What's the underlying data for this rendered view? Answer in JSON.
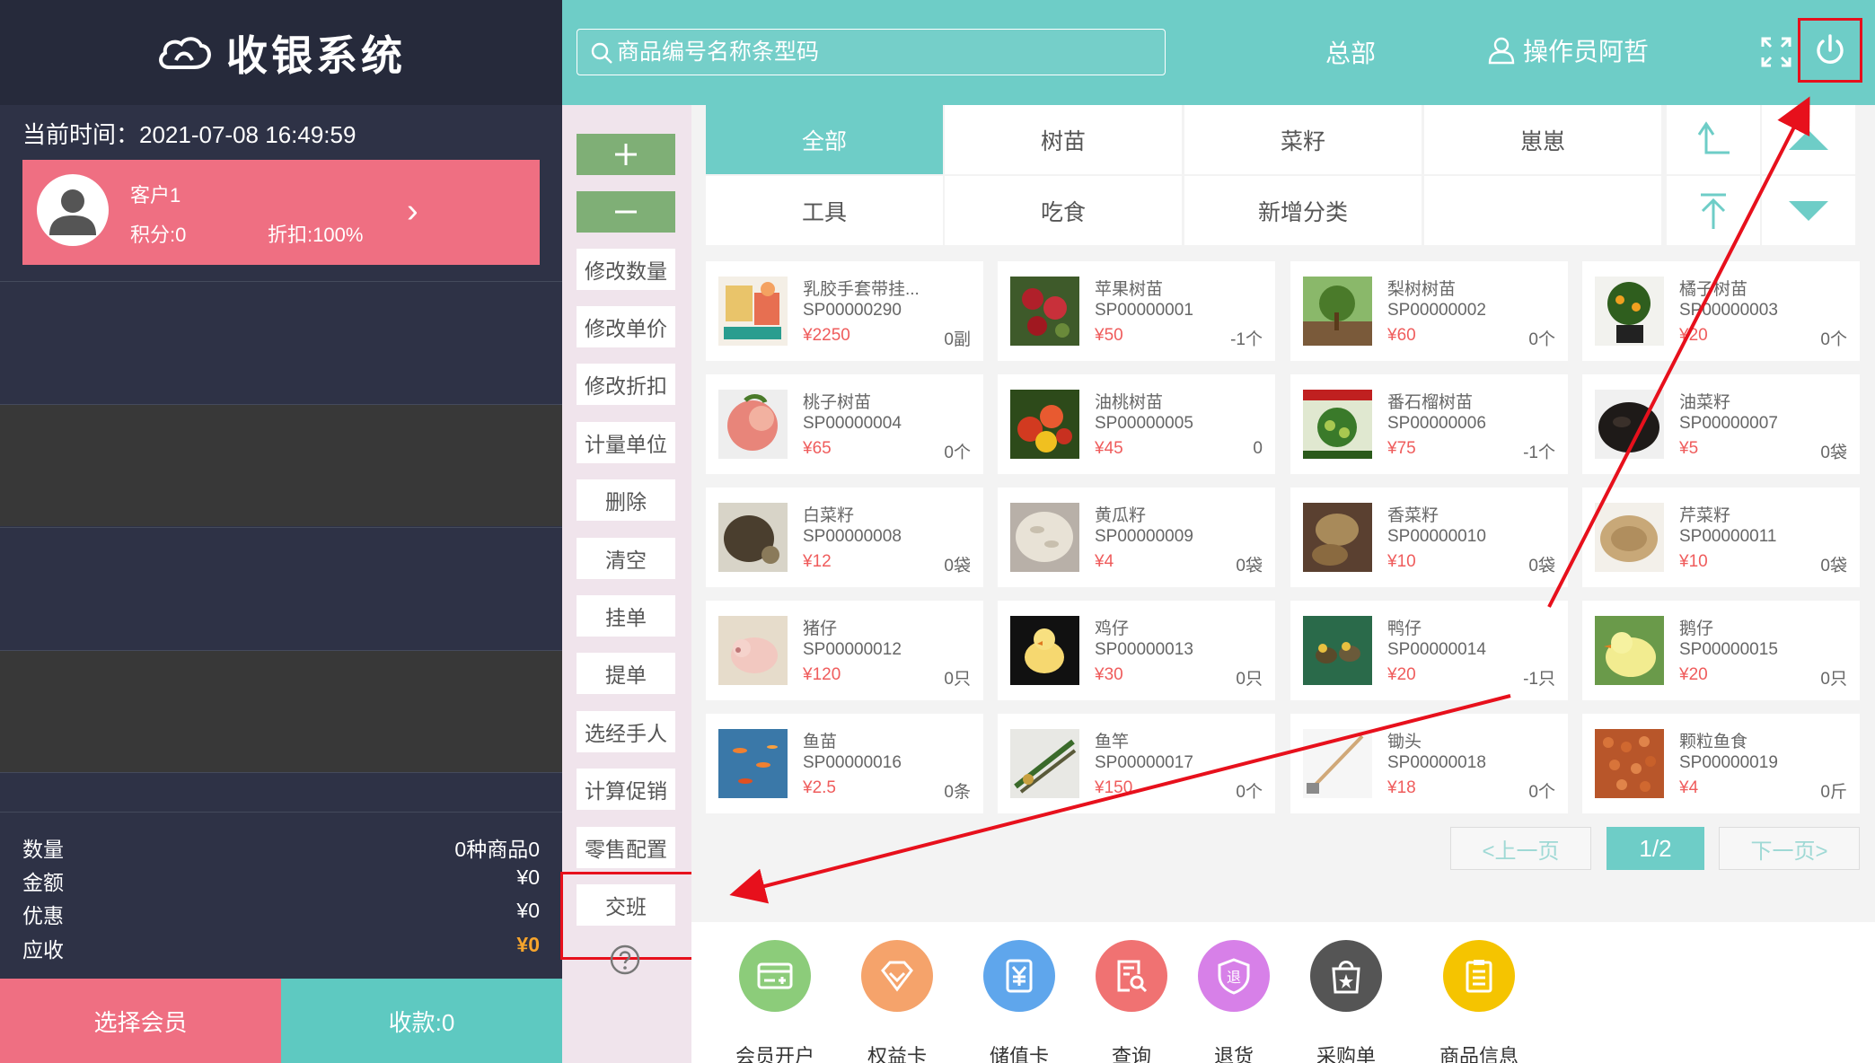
{
  "app": {
    "title": "收银系统"
  },
  "left": {
    "time_label": "当前时间：",
    "time_value": "2021-07-08 16:49:59",
    "customer": {
      "name": "客户1",
      "points": "积分:0",
      "discount": "折扣:100%",
      "arrow": "›"
    },
    "summary": {
      "qty_label": "数量",
      "qty_value": "0种商品0",
      "amount_label": "金额",
      "amount_value": "¥0",
      "discount_label": "优惠",
      "discount_value": "¥0",
      "due_label": "应收",
      "due_value": "¥0"
    },
    "select_member": "选择会员",
    "collect": "收款:0"
  },
  "topbar": {
    "search_placeholder": "商品编号名称条型码",
    "store": "总部",
    "operator": "操作员阿哲",
    "icons": [
      "search-icon",
      "user-icon",
      "fullscreen-icon",
      "power-icon"
    ]
  },
  "functions": {
    "add": "+",
    "minus": "—",
    "buttons": [
      "修改数量",
      "修改单价",
      "修改折扣",
      "计量单位",
      "删除",
      "清空",
      "挂单",
      "提单",
      "选经手人",
      "计算促销",
      "零售配置",
      "交班"
    ]
  },
  "categories": {
    "row1": [
      "全部",
      "树苗",
      "菜籽",
      "崽崽"
    ],
    "row2": [
      "工具",
      "吃食",
      "新增分类",
      ""
    ],
    "active": "全部"
  },
  "products": [
    {
      "name": "乳胶手套带挂...",
      "code": "SP00000290",
      "price": "¥2250",
      "stock": "0副",
      "img": "gloves"
    },
    {
      "name": "苹果树苗",
      "code": "SP00000001",
      "price": "¥50",
      "stock": "-1个",
      "img": "apple"
    },
    {
      "name": "梨树树苗",
      "code": "SP00000002",
      "price": "¥60",
      "stock": "0个",
      "img": "peartree"
    },
    {
      "name": "橘子树苗",
      "code": "SP00000003",
      "price": "¥20",
      "stock": "0个",
      "img": "orange"
    },
    {
      "name": "桃子树苗",
      "code": "SP00000004",
      "price": "¥65",
      "stock": "0个",
      "img": "peach"
    },
    {
      "name": "油桃树苗",
      "code": "SP00000005",
      "price": "¥45",
      "stock": "0",
      "img": "nectarine"
    },
    {
      "name": "番石榴树苗",
      "code": "SP00000006",
      "price": "¥75",
      "stock": "-1个",
      "img": "guava"
    },
    {
      "name": "油菜籽",
      "code": "SP00000007",
      "price": "¥5",
      "stock": "0袋",
      "img": "rapeseed"
    },
    {
      "name": "白菜籽",
      "code": "SP00000008",
      "price": "¥12",
      "stock": "0袋",
      "img": "cabbageseed"
    },
    {
      "name": "黄瓜籽",
      "code": "SP00000009",
      "price": "¥4",
      "stock": "0袋",
      "img": "cucumberseed"
    },
    {
      "name": "香菜籽",
      "code": "SP00000010",
      "price": "¥10",
      "stock": "0袋",
      "img": "coriander"
    },
    {
      "name": "芹菜籽",
      "code": "SP00000011",
      "price": "¥10",
      "stock": "0袋",
      "img": "celery"
    },
    {
      "name": "猪仔",
      "code": "SP00000012",
      "price": "¥120",
      "stock": "0只",
      "img": "piglet"
    },
    {
      "name": "鸡仔",
      "code": "SP00000013",
      "price": "¥30",
      "stock": "0只",
      "img": "chick"
    },
    {
      "name": "鸭仔",
      "code": "SP00000014",
      "price": "¥20",
      "stock": "-1只",
      "img": "duckling"
    },
    {
      "name": "鹅仔",
      "code": "SP00000015",
      "price": "¥20",
      "stock": "0只",
      "img": "gosling"
    },
    {
      "name": "鱼苗",
      "code": "SP00000016",
      "price": "¥2.5",
      "stock": "0条",
      "img": "fish"
    },
    {
      "name": "鱼竿",
      "code": "SP00000017",
      "price": "¥150",
      "stock": "0个",
      "img": "rod"
    },
    {
      "name": "锄头",
      "code": "SP00000018",
      "price": "¥18",
      "stock": "0个",
      "img": "hoe"
    },
    {
      "name": "颗粒鱼食",
      "code": "SP00000019",
      "price": "¥4",
      "stock": "0斤",
      "img": "fishfood"
    }
  ],
  "pager": {
    "prev": "<上一页",
    "current": "1/2",
    "next": "下一页>"
  },
  "shortcuts": [
    {
      "label": "会员开户",
      "color": "#8ccc7a",
      "icon": "member-card-icon"
    },
    {
      "label": "权益卡",
      "color": "#f5a36b",
      "icon": "diamond-icon"
    },
    {
      "label": "储值卡",
      "color": "#5fa6ec",
      "icon": "yen-card-icon"
    },
    {
      "label": "查询",
      "color": "#f07272",
      "icon": "search-doc-icon"
    },
    {
      "label": "退货",
      "color": "#d780e8",
      "icon": "return-shield-icon"
    },
    {
      "label": "采购单",
      "color": "#555555",
      "icon": "shopping-bag-icon"
    },
    {
      "label": "商品信息",
      "color": "#f5c400",
      "icon": "clipboard-icon"
    }
  ],
  "colors": {
    "teal": "#6ecdc7",
    "pink": "#ef6f82",
    "dark": "#2e3246",
    "annotation_red": "#e7101c"
  }
}
